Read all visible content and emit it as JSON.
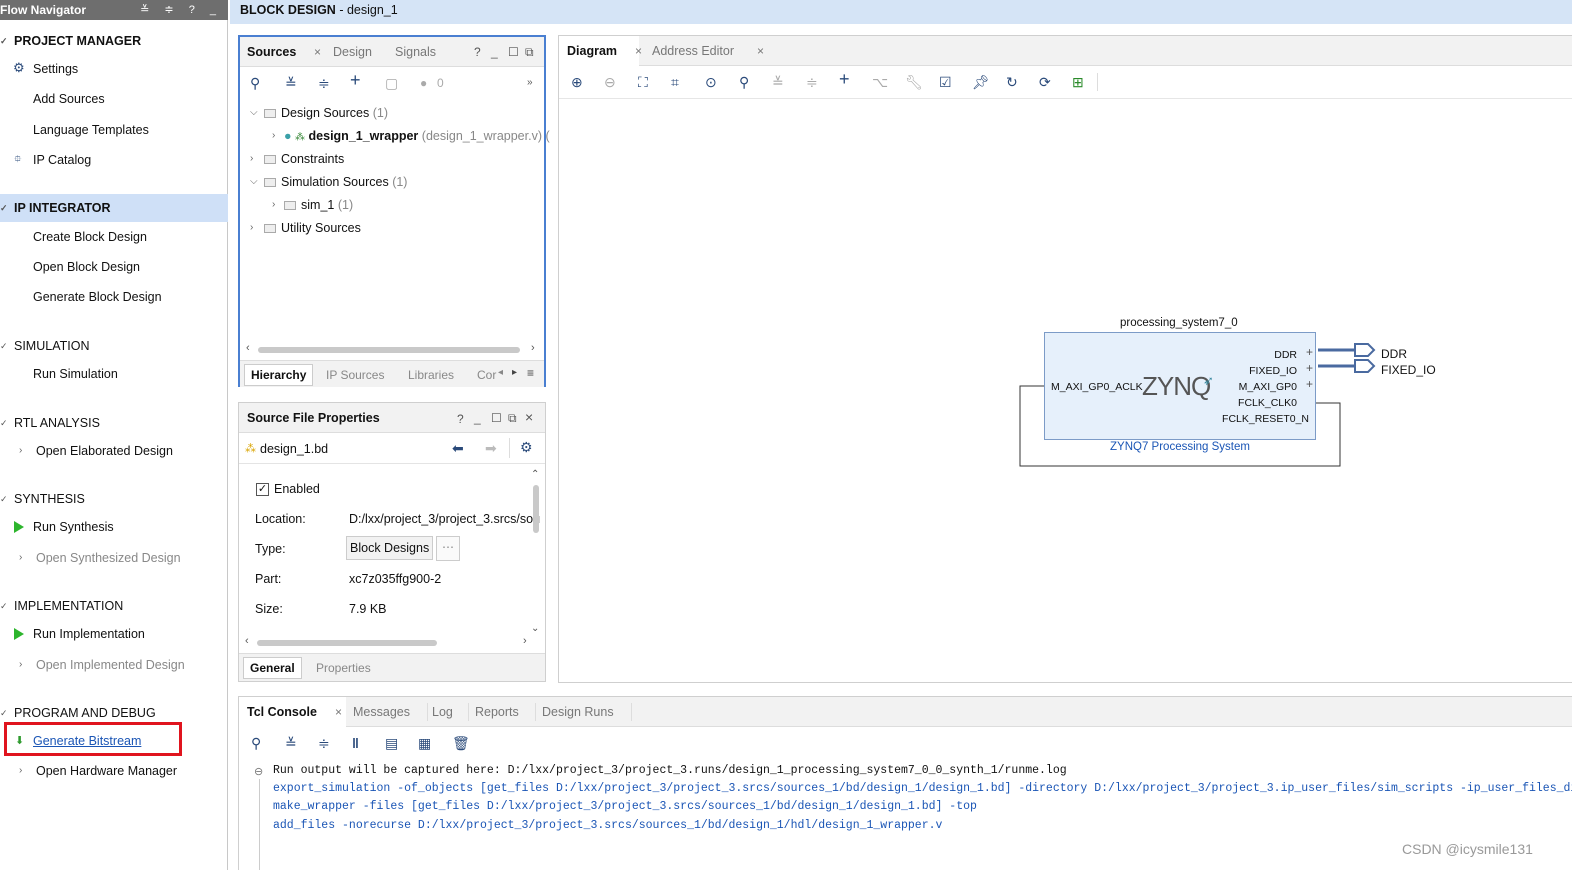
{
  "nav": {
    "header": "Flow Navigator",
    "header_controls": "≚ ≑ ? _",
    "sections": [
      {
        "label": "PROJECT MANAGER",
        "items": [
          "Settings",
          "Add Sources",
          "Language Templates",
          "IP Catalog"
        ]
      },
      {
        "label": "IP INTEGRATOR",
        "items": [
          "Create Block Design",
          "Open Block Design",
          "Generate Block Design"
        ]
      },
      {
        "label": "SIMULATION",
        "items": [
          "Run Simulation"
        ]
      },
      {
        "label": "RTL ANALYSIS",
        "items": [
          "Open Elaborated Design"
        ]
      },
      {
        "label": "SYNTHESIS",
        "items": [
          "Run Synthesis",
          "Open Synthesized Design"
        ]
      },
      {
        "label": "IMPLEMENTATION",
        "items": [
          "Run Implementation",
          "Open Implemented Design"
        ]
      },
      {
        "label": "PROGRAM AND DEBUG",
        "items": [
          "Generate Bitstream",
          "Open Hardware Manager"
        ]
      }
    ]
  },
  "title": {
    "bold": "BLOCK DESIGN",
    "rest": " - design_1"
  },
  "sources": {
    "tabs": [
      "Sources",
      "Design",
      "Signals"
    ],
    "badge": "0",
    "tree": {
      "design_sources": "Design Sources",
      "design_sources_count": "(1)",
      "wrapper": "design_1_wrapper",
      "wrapper_file": "(design_1_wrapper.v) (",
      "constraints": "Constraints",
      "sim_sources": "Simulation Sources",
      "sim_sources_count": "(1)",
      "sim1": "sim_1",
      "sim1_count": "(1)",
      "utility": "Utility Sources"
    },
    "bottom_tabs": [
      "Hierarchy",
      "IP Sources",
      "Libraries",
      "Cor"
    ]
  },
  "sfp": {
    "title": "Source File Properties",
    "file": "design_1.bd",
    "enabled": "Enabled",
    "rows": [
      {
        "k": "Location:",
        "v": "D:/lxx/project_3/project_3.srcs/sou"
      },
      {
        "k": "Type:",
        "v": "Block Designs"
      },
      {
        "k": "Part:",
        "v": "xc7z035ffg900-2"
      },
      {
        "k": "Size:",
        "v": "7.9 KB"
      }
    ],
    "bottom_tabs": [
      "General",
      "Properties"
    ]
  },
  "diagram": {
    "tabs": [
      "Diagram",
      "Address Editor"
    ],
    "block_name": "processing_system7_0",
    "block_caption": "ZYNQ7 Processing System",
    "logo": "ZYNQ",
    "left_pin": "M_AXI_GP0_ACLK",
    "right_pins": [
      "DDR",
      "FIXED_IO",
      "M_AXI_GP0",
      "FCLK_CLK0",
      "FCLK_RESET0_N"
    ],
    "ports": [
      "DDR",
      "FIXED_IO"
    ]
  },
  "console": {
    "tabs": [
      "Tcl Console",
      "Messages",
      "Log",
      "Reports",
      "Design Runs"
    ],
    "lines": [
      "Run output will be captured here: D:/lxx/project_3/project_3.runs/design_1_processing_system7_0_0_synth_1/runme.log",
      "export_simulation -of_objects [get_files D:/lxx/project_3/project_3.srcs/sources_1/bd/design_1/design_1.bd] -directory D:/lxx/project_3/project_3.ip_user_files/sim_scripts -ip_user_files_dir D:/lxx/proje",
      "make_wrapper -files [get_files D:/lxx/project_3/project_3.srcs/sources_1/bd/design_1/design_1.bd] -top",
      "add_files -norecurse D:/lxx/project_3/project_3.srcs/sources_1/bd/design_1/hdl/design_1_wrapper.v"
    ]
  },
  "watermark": "CSDN @icysmile131",
  "colors": {
    "accent": "#1a55b5",
    "highlight": "#e0141e",
    "selection": "#cfe0f7",
    "run": "#2db52d"
  }
}
